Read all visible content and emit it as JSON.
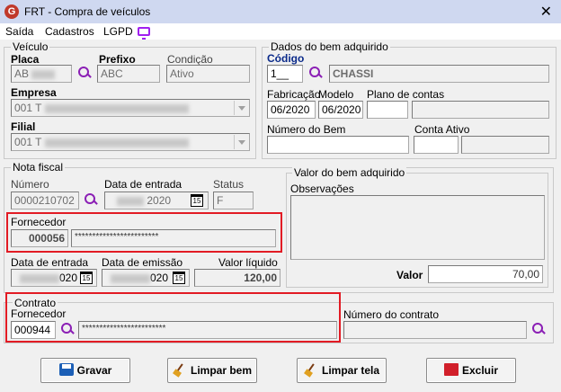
{
  "window": {
    "title": "FRT - Compra de veículos",
    "logo_letter": "G",
    "close_glyph": "✕"
  },
  "menu": {
    "items": [
      "Saída",
      "Cadastros",
      "LGPD"
    ]
  },
  "veiculo": {
    "legend": "Veículo",
    "placa_label": "Placa",
    "placa_value": "AB",
    "prefixo_label": "Prefixo",
    "prefixo_value": "ABC",
    "condicao_label": "Condição",
    "condicao_value": "Ativo",
    "empresa_label": "Empresa",
    "empresa_value": "001 T",
    "filial_label": "Filial",
    "filial_value": "001 T"
  },
  "bem": {
    "legend": "Dados do bem adquirido",
    "codigo_label": "Código",
    "codigo_value": "1__",
    "chassi_value": "CHASSI",
    "fabricacao_label": "Fabricação",
    "fabricacao_value": "06/2020",
    "modelo_label": "Modelo",
    "modelo_value": "06/2020",
    "plano_label": "Plano de contas",
    "numero_bem_label": "Número do Bem",
    "conta_ativo_label": "Conta Ativo"
  },
  "nota": {
    "legend": "Nota fiscal",
    "numero_label": "Número",
    "numero_value": "0000210702",
    "data_entrada_label": "Data de entrada",
    "data_entrada_value": "2020",
    "status_label": "Status",
    "status_value": "F",
    "fornecedor_label": "Fornecedor",
    "fornecedor_code": "000056",
    "fornecedor_name": "************************",
    "data_entrada2_label": "Data de entrada",
    "data_entrada2_value": "020",
    "data_emissao_label": "Data de emissão",
    "data_emissao_value": "020",
    "valor_liquido_label": "Valor líquido",
    "valor_liquido_value": "120,00"
  },
  "valor_bem": {
    "legend": "Valor do bem adquirido",
    "observacoes_label": "Observações",
    "valor_label": "Valor",
    "valor_value": "70,00"
  },
  "contrato": {
    "legend": "Contrato",
    "fornecedor_label": "Fornecedor",
    "fornecedor_code": "000944",
    "fornecedor_name": "************************",
    "numero_label": "Número do contrato"
  },
  "calendar_glyph": "15",
  "buttons": {
    "gravar": "Gravar",
    "limpar_bem": "Limpar bem",
    "limpar_tela": "Limpar tela",
    "excluir": "Excluir"
  }
}
